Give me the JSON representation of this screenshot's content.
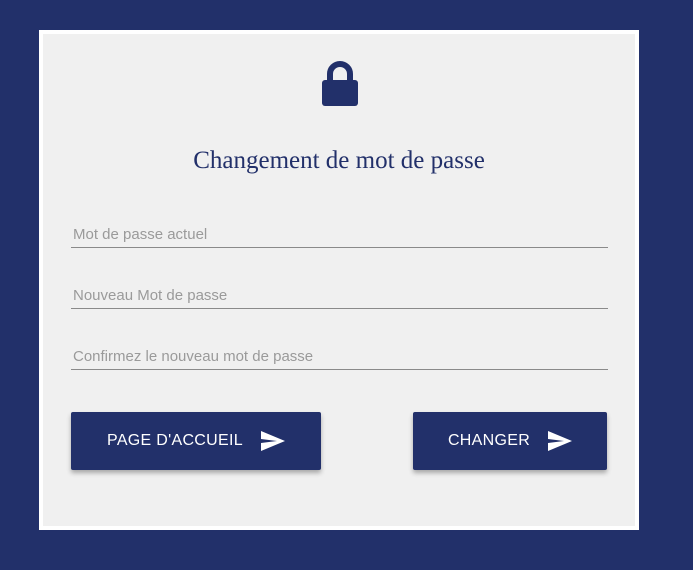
{
  "colors": {
    "background": "#22306a",
    "card": "#f0f0f0",
    "accent": "#22306a",
    "button_text": "#ffffff",
    "placeholder": "#9a9a9a"
  },
  "header": {
    "icon": "lock-icon",
    "title": "Changement de mot de passe"
  },
  "form": {
    "current_password": {
      "placeholder": "Mot de passe actuel",
      "value": ""
    },
    "new_password": {
      "placeholder": "Nouveau Mot de passe",
      "value": ""
    },
    "confirm_password": {
      "placeholder": "Confirmez le nouveau mot de passe",
      "value": ""
    }
  },
  "buttons": {
    "home": {
      "label": "PAGE D'ACCUEIL",
      "icon": "send-icon"
    },
    "change": {
      "label": "CHANGER",
      "icon": "send-icon"
    }
  }
}
